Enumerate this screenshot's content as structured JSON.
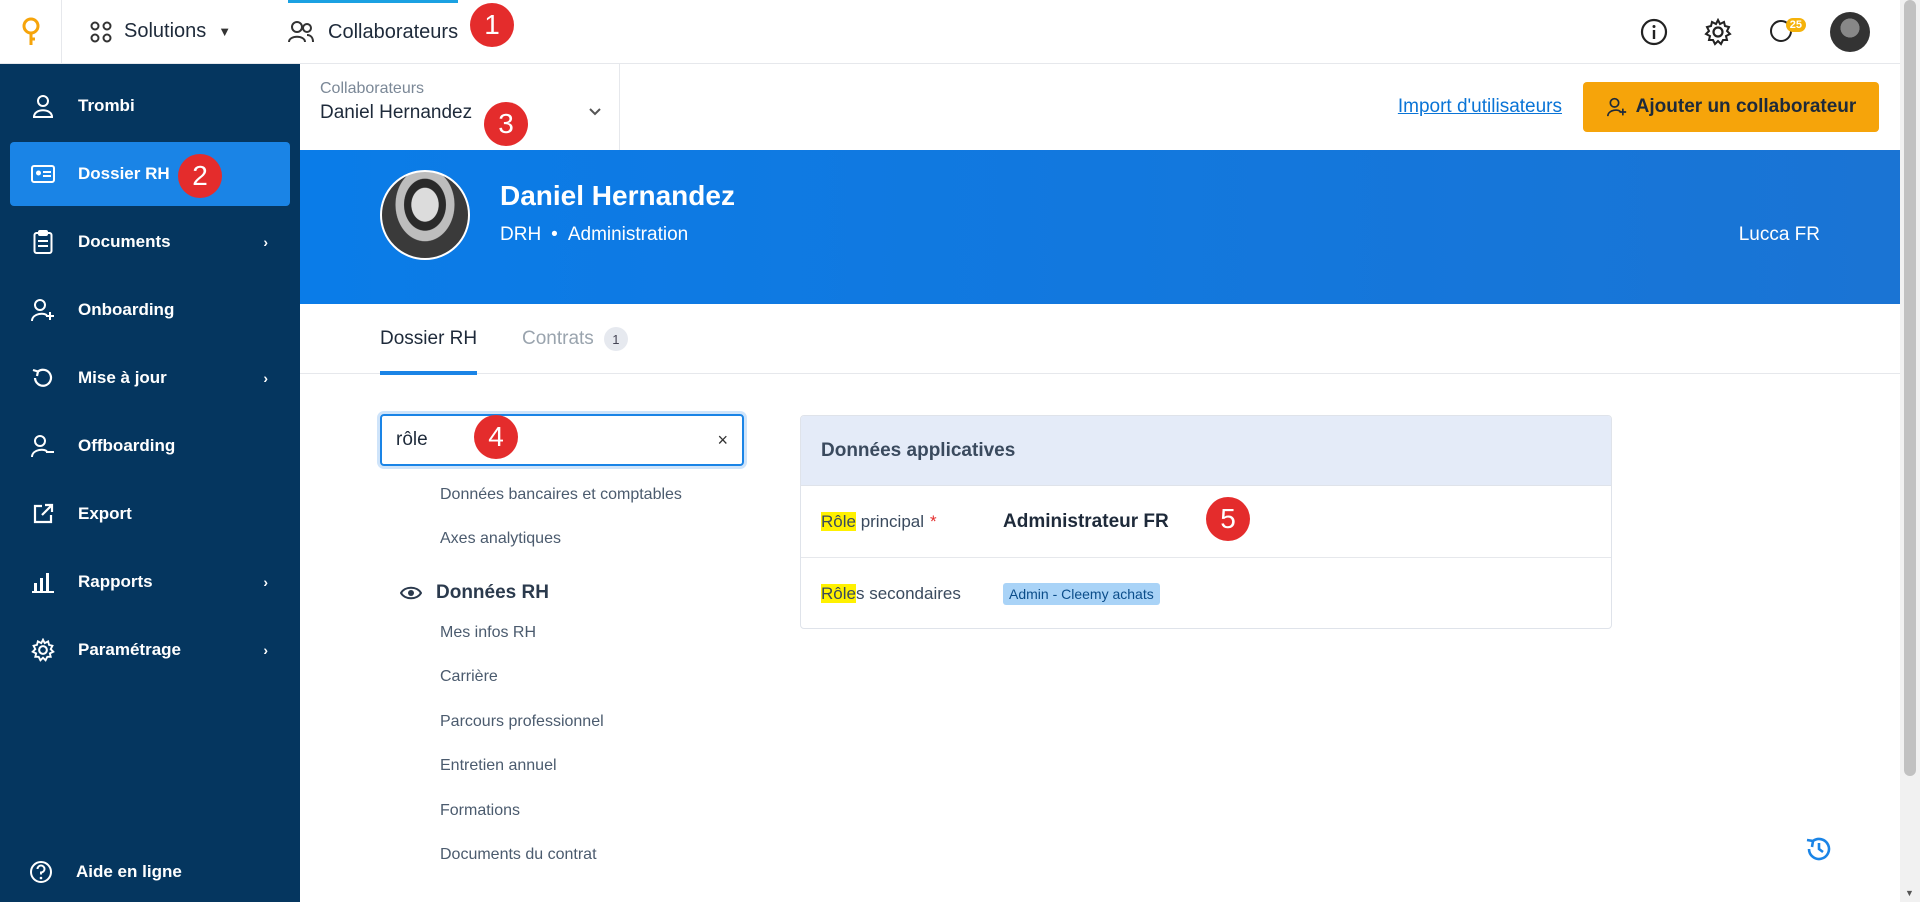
{
  "topbar": {
    "solutions_label": "Solutions",
    "active_tab_label": "Collaborateurs",
    "notification_count": "25"
  },
  "markers": [
    "1",
    "2",
    "3",
    "4",
    "5"
  ],
  "sidebar": {
    "items": [
      {
        "label": "Trombi",
        "icon": "user-icon",
        "has_arrow": false
      },
      {
        "label": "Dossier RH",
        "icon": "id-card-icon",
        "has_arrow": false,
        "active": true
      },
      {
        "label": "Documents",
        "icon": "clipboard-icon",
        "has_arrow": true
      },
      {
        "label": "Onboarding",
        "icon": "user-plus-icon",
        "has_arrow": false
      },
      {
        "label": "Mise à jour",
        "icon": "refresh-icon",
        "has_arrow": true
      },
      {
        "label": "Offboarding",
        "icon": "user-minus-icon",
        "has_arrow": false
      },
      {
        "label": "Export",
        "icon": "external-link-icon",
        "has_arrow": false
      },
      {
        "label": "Rapports",
        "icon": "bar-chart-icon",
        "has_arrow": true
      },
      {
        "label": "Paramétrage",
        "icon": "gear-icon",
        "has_arrow": true
      }
    ],
    "help_label": "Aide en ligne",
    "arrow_glyph": "›"
  },
  "subheader": {
    "selector_label": "Collaborateurs",
    "selector_value": "Daniel Hernandez",
    "import_link": "Import d'utilisateurs",
    "add_button": "Ajouter un collaborateur"
  },
  "banner": {
    "name": "Daniel Hernandez",
    "job": "DRH",
    "separator": "•",
    "department": "Administration",
    "entity": "Lucca FR"
  },
  "tabs": [
    {
      "label": "Dossier RH",
      "active": true
    },
    {
      "label": "Contrats",
      "count": "1"
    }
  ],
  "search": {
    "value": "rôle",
    "clear_glyph": "×"
  },
  "nav": {
    "top_links": [
      "Données bancaires et comptables",
      "Axes analytiques"
    ],
    "section_title": "Données RH",
    "section_links": [
      "Mes infos RH",
      "Carrière",
      "Parcours professionnel",
      "Entretien annuel",
      "Formations",
      "Documents du contrat"
    ]
  },
  "panel": {
    "title": "Données applicatives",
    "rows": [
      {
        "label_hl": "Rôle",
        "label_rest": " principal",
        "required": "*",
        "value": "Administrateur FR"
      },
      {
        "label_hl": "Rôle",
        "label_rest": "s secondaires",
        "chip": "Admin - Cleemy achats"
      }
    ]
  },
  "colors": {
    "sidebar_bg": "#05365f",
    "active_item": "#1a84e6",
    "banner": "#0a7ce8",
    "cta": "#f6a40a",
    "highlight": "#fff100",
    "marker": "#e42c2c"
  }
}
